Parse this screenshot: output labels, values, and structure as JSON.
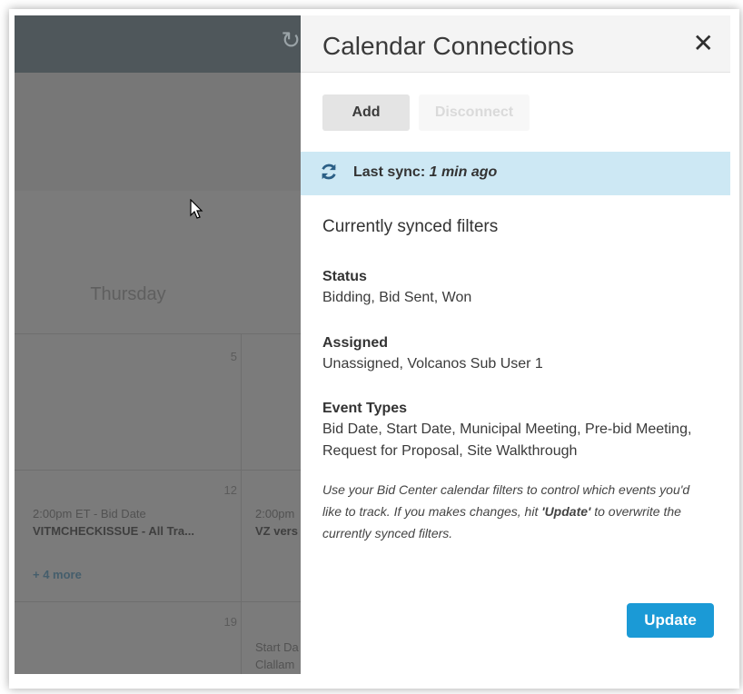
{
  "background_calendar": {
    "day_name": "Thursday",
    "day_numbers": [
      "5",
      "12",
      "19"
    ],
    "events": [
      {
        "time": "2:00pm ET - Bid Date",
        "title": "VITMCHECKISSUE - All Tra..."
      },
      {
        "time": "2:00pm",
        "title": "VZ vers"
      },
      {
        "time": "Start Da",
        "title": "Clallam"
      }
    ],
    "more_link": "+ 4 more"
  },
  "panel": {
    "title": "Calendar Connections",
    "close_glyph": "✕",
    "buttons": {
      "add": "Add",
      "disconnect": "Disconnect",
      "update": "Update"
    },
    "sync": {
      "label": "Last sync:",
      "value": "1 min ago"
    },
    "section_title": "Currently synced filters",
    "filters": [
      {
        "label": "Status",
        "value": "Bidding, Bid Sent, Won"
      },
      {
        "label": "Assigned",
        "value": "Unassigned, Volcanos Sub User 1"
      },
      {
        "label": "Event Types",
        "value": "Bid Date, Start Date, Municipal Meeting, Pre-bid Meeting, Request for Proposal, Site Walkthrough"
      }
    ],
    "hint": {
      "before": "Use your Bid Center calendar filters to control which events you'd like to track. If you makes changes, hit ",
      "emph": "'Update'",
      "after": " to overwrite the currently synced filters."
    }
  },
  "colors": {
    "accent": "#1b9ad6",
    "sync_bar": "#cde8f4",
    "overlay": "#7b7b7b"
  },
  "icons": [
    "refresh-icon",
    "sync-icon",
    "close-icon",
    "mouse-cursor-icon"
  ]
}
